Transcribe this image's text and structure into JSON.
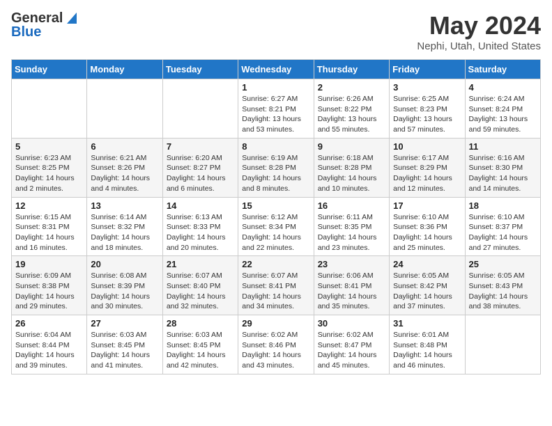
{
  "logo": {
    "general": "General",
    "blue": "Blue"
  },
  "title": "May 2024",
  "location": "Nephi, Utah, United States",
  "days_header": [
    "Sunday",
    "Monday",
    "Tuesday",
    "Wednesday",
    "Thursday",
    "Friday",
    "Saturday"
  ],
  "weeks": [
    [
      {
        "day": "",
        "info": ""
      },
      {
        "day": "",
        "info": ""
      },
      {
        "day": "",
        "info": ""
      },
      {
        "day": "1",
        "info": "Sunrise: 6:27 AM\nSunset: 8:21 PM\nDaylight: 13 hours\nand 53 minutes."
      },
      {
        "day": "2",
        "info": "Sunrise: 6:26 AM\nSunset: 8:22 PM\nDaylight: 13 hours\nand 55 minutes."
      },
      {
        "day": "3",
        "info": "Sunrise: 6:25 AM\nSunset: 8:23 PM\nDaylight: 13 hours\nand 57 minutes."
      },
      {
        "day": "4",
        "info": "Sunrise: 6:24 AM\nSunset: 8:24 PM\nDaylight: 13 hours\nand 59 minutes."
      }
    ],
    [
      {
        "day": "5",
        "info": "Sunrise: 6:23 AM\nSunset: 8:25 PM\nDaylight: 14 hours\nand 2 minutes."
      },
      {
        "day": "6",
        "info": "Sunrise: 6:21 AM\nSunset: 8:26 PM\nDaylight: 14 hours\nand 4 minutes."
      },
      {
        "day": "7",
        "info": "Sunrise: 6:20 AM\nSunset: 8:27 PM\nDaylight: 14 hours\nand 6 minutes."
      },
      {
        "day": "8",
        "info": "Sunrise: 6:19 AM\nSunset: 8:28 PM\nDaylight: 14 hours\nand 8 minutes."
      },
      {
        "day": "9",
        "info": "Sunrise: 6:18 AM\nSunset: 8:28 PM\nDaylight: 14 hours\nand 10 minutes."
      },
      {
        "day": "10",
        "info": "Sunrise: 6:17 AM\nSunset: 8:29 PM\nDaylight: 14 hours\nand 12 minutes."
      },
      {
        "day": "11",
        "info": "Sunrise: 6:16 AM\nSunset: 8:30 PM\nDaylight: 14 hours\nand 14 minutes."
      }
    ],
    [
      {
        "day": "12",
        "info": "Sunrise: 6:15 AM\nSunset: 8:31 PM\nDaylight: 14 hours\nand 16 minutes."
      },
      {
        "day": "13",
        "info": "Sunrise: 6:14 AM\nSunset: 8:32 PM\nDaylight: 14 hours\nand 18 minutes."
      },
      {
        "day": "14",
        "info": "Sunrise: 6:13 AM\nSunset: 8:33 PM\nDaylight: 14 hours\nand 20 minutes."
      },
      {
        "day": "15",
        "info": "Sunrise: 6:12 AM\nSunset: 8:34 PM\nDaylight: 14 hours\nand 22 minutes."
      },
      {
        "day": "16",
        "info": "Sunrise: 6:11 AM\nSunset: 8:35 PM\nDaylight: 14 hours\nand 23 minutes."
      },
      {
        "day": "17",
        "info": "Sunrise: 6:10 AM\nSunset: 8:36 PM\nDaylight: 14 hours\nand 25 minutes."
      },
      {
        "day": "18",
        "info": "Sunrise: 6:10 AM\nSunset: 8:37 PM\nDaylight: 14 hours\nand 27 minutes."
      }
    ],
    [
      {
        "day": "19",
        "info": "Sunrise: 6:09 AM\nSunset: 8:38 PM\nDaylight: 14 hours\nand 29 minutes."
      },
      {
        "day": "20",
        "info": "Sunrise: 6:08 AM\nSunset: 8:39 PM\nDaylight: 14 hours\nand 30 minutes."
      },
      {
        "day": "21",
        "info": "Sunrise: 6:07 AM\nSunset: 8:40 PM\nDaylight: 14 hours\nand 32 minutes."
      },
      {
        "day": "22",
        "info": "Sunrise: 6:07 AM\nSunset: 8:41 PM\nDaylight: 14 hours\nand 34 minutes."
      },
      {
        "day": "23",
        "info": "Sunrise: 6:06 AM\nSunset: 8:41 PM\nDaylight: 14 hours\nand 35 minutes."
      },
      {
        "day": "24",
        "info": "Sunrise: 6:05 AM\nSunset: 8:42 PM\nDaylight: 14 hours\nand 37 minutes."
      },
      {
        "day": "25",
        "info": "Sunrise: 6:05 AM\nSunset: 8:43 PM\nDaylight: 14 hours\nand 38 minutes."
      }
    ],
    [
      {
        "day": "26",
        "info": "Sunrise: 6:04 AM\nSunset: 8:44 PM\nDaylight: 14 hours\nand 39 minutes."
      },
      {
        "day": "27",
        "info": "Sunrise: 6:03 AM\nSunset: 8:45 PM\nDaylight: 14 hours\nand 41 minutes."
      },
      {
        "day": "28",
        "info": "Sunrise: 6:03 AM\nSunset: 8:45 PM\nDaylight: 14 hours\nand 42 minutes."
      },
      {
        "day": "29",
        "info": "Sunrise: 6:02 AM\nSunset: 8:46 PM\nDaylight: 14 hours\nand 43 minutes."
      },
      {
        "day": "30",
        "info": "Sunrise: 6:02 AM\nSunset: 8:47 PM\nDaylight: 14 hours\nand 45 minutes."
      },
      {
        "day": "31",
        "info": "Sunrise: 6:01 AM\nSunset: 8:48 PM\nDaylight: 14 hours\nand 46 minutes."
      },
      {
        "day": "",
        "info": ""
      }
    ]
  ]
}
